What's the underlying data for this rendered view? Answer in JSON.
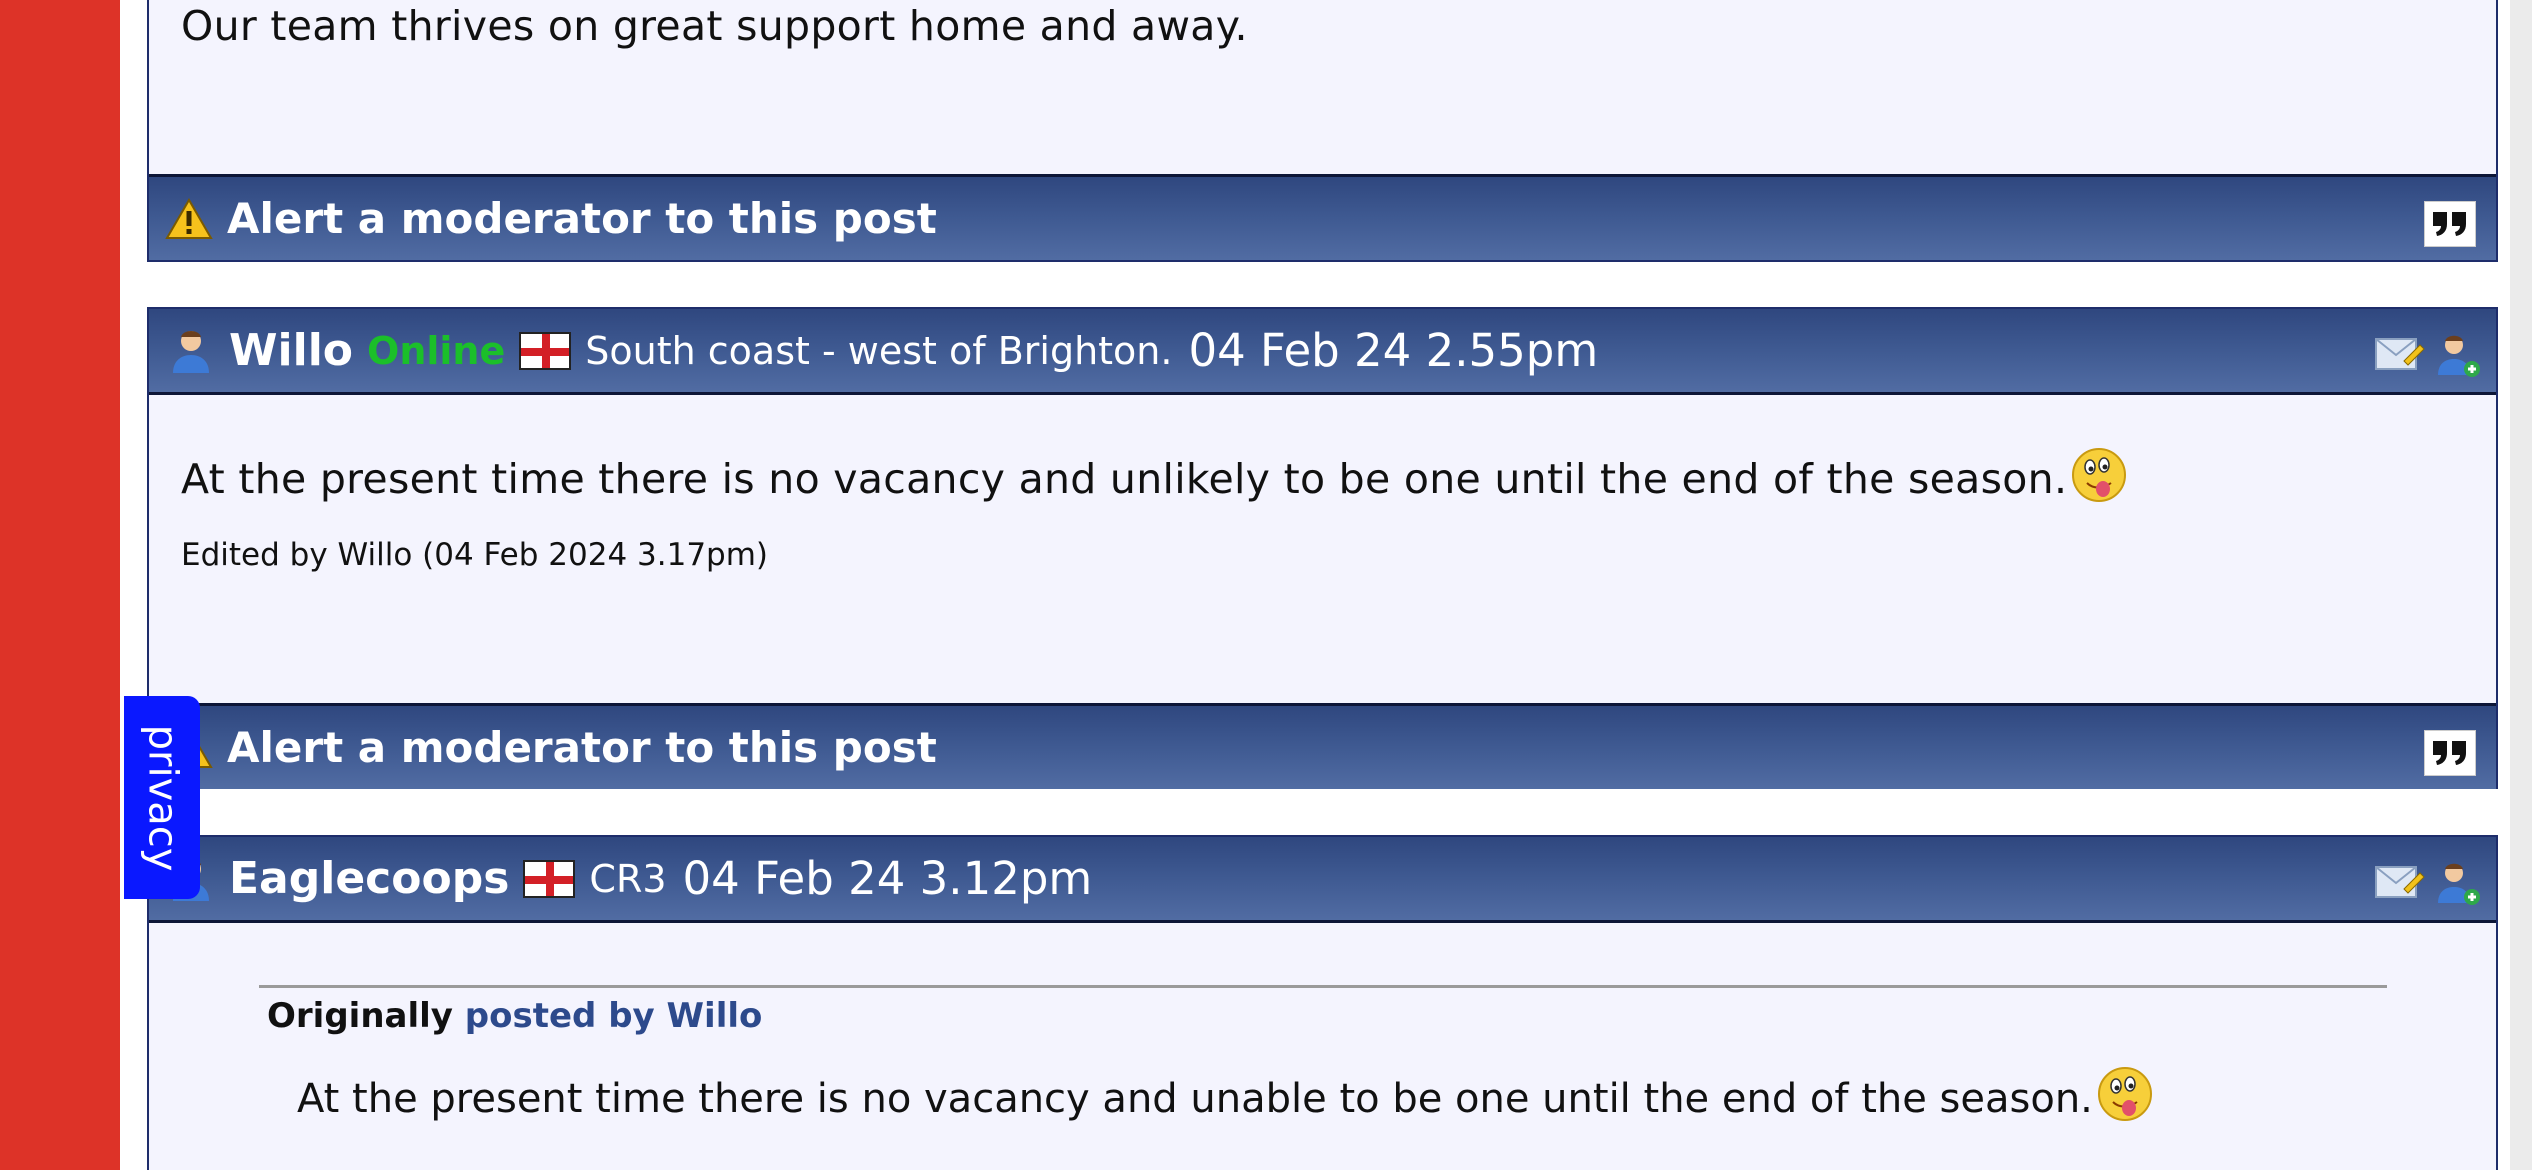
{
  "colors": {
    "rail": "#dd3328",
    "panel_bg": "#f4f4fe",
    "bar": "#3f5a92",
    "online": "#1bbf2a",
    "privacy": "#0a18ff",
    "quote_author": "#2d4a8c"
  },
  "post_top": {
    "text": "Our team thrives on great support home and away.",
    "alert_label": "Alert a moderator to this post"
  },
  "post_willo": {
    "username": "Willo",
    "status": "Online",
    "location": "South coast - west of Brighton.",
    "timestamp": "04 Feb 24 2.55pm",
    "text": "At the present time there is no vacancy and unlikely to be one until the end of the season.",
    "edit_note": "Edited by Willo (04 Feb 2024 3.17pm)",
    "alert_label": "Alert a moderator to this post"
  },
  "post_eaglecoops": {
    "username": "Eaglecoops",
    "location": "CR3",
    "timestamp": "04 Feb 24 3.12pm",
    "quote_prefix": "Originally",
    "quote_by": "posted by Willo",
    "quote_text": "At the present time there is no vacancy and unable to be one until the end of the season."
  },
  "privacy": {
    "label": "privacy"
  },
  "icons": [
    "warning-icon",
    "quote-icon",
    "user-icon",
    "england-flag-icon",
    "private-message-icon",
    "add-friend-icon",
    "tongue-out-emoji-icon"
  ]
}
